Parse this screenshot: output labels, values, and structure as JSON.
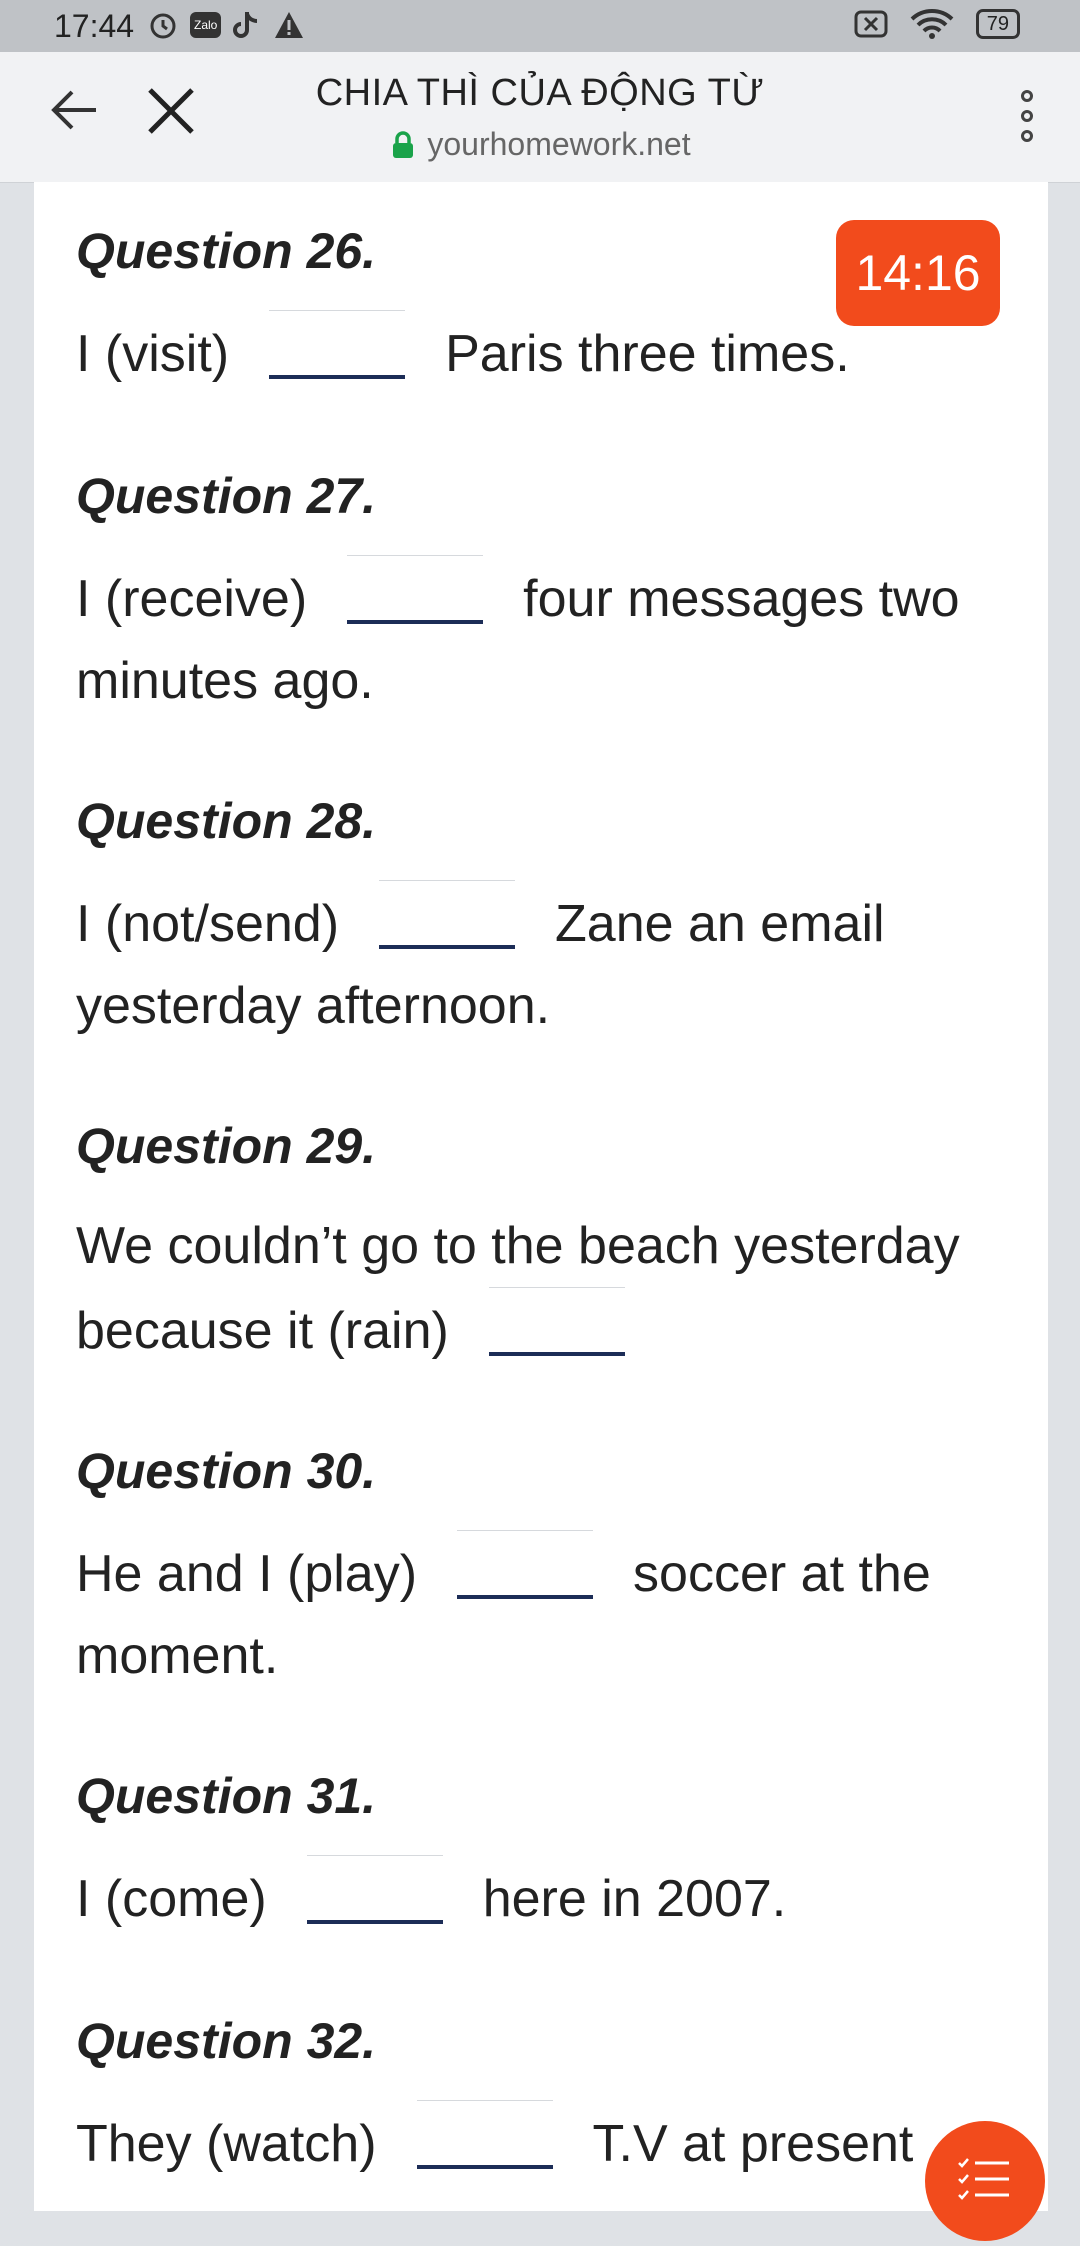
{
  "status_bar": {
    "time": "17:44",
    "zalo_label": "Zalo",
    "battery": "79"
  },
  "app_bar": {
    "title": "CHIA THÌ CỦA ĐỘNG TỪ",
    "url": "yourhomework.net"
  },
  "timer": "14:16",
  "questions": [
    {
      "head": "Question 26.",
      "before": "I (visit)",
      "after": "Paris three times."
    },
    {
      "head": "Question 27.",
      "before": "I (receive)",
      "after": "four messages two minutes ago."
    },
    {
      "head": "Question 28.",
      "before": "I (not/send)",
      "after": "Zane an email yesterday afternoon."
    },
    {
      "head": "Question 29.",
      "before": "We couldn’t go to the beach yesterday because it (rain)",
      "after": ""
    },
    {
      "head": "Question 30.",
      "before": "He and I (play)",
      "after": "soccer at the moment."
    },
    {
      "head": "Question 31.",
      "before": "I (come)",
      "after": "here in 2007."
    },
    {
      "head": "Question 32.",
      "before": "They (watch)",
      "after": "T.V at present"
    }
  ],
  "colors": {
    "accent": "#f24b1c",
    "blank_underline": "#1c2d57",
    "secure_lock": "#1aa34a"
  }
}
